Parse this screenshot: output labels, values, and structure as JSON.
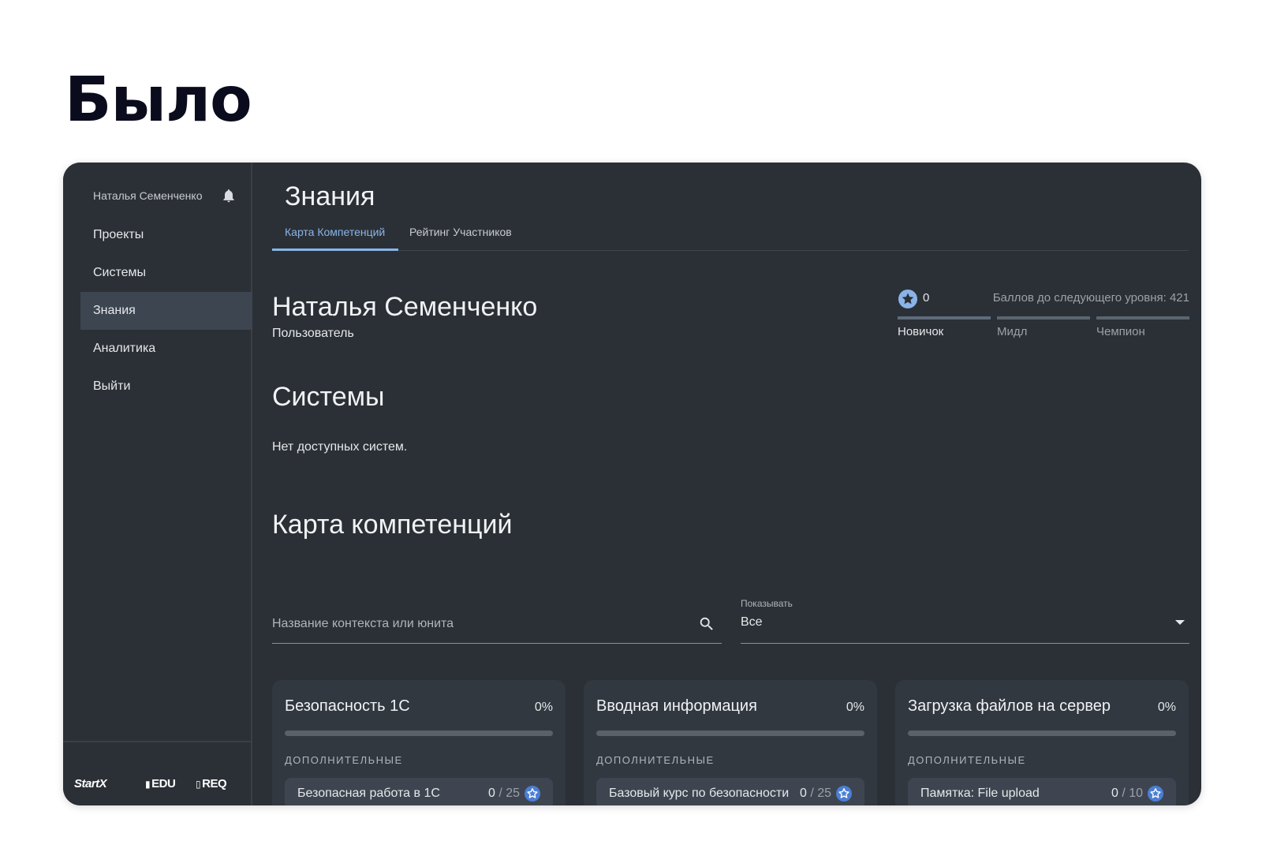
{
  "slide": {
    "title": "Было"
  },
  "sidebar": {
    "user_name": "Наталья Семенченко",
    "items": [
      {
        "label": "Проекты",
        "active": false
      },
      {
        "label": "Системы",
        "active": false
      },
      {
        "label": "Знания",
        "active": true
      },
      {
        "label": "Аналитика",
        "active": false
      },
      {
        "label": "Выйти",
        "active": false
      }
    ],
    "logos": [
      "StartX",
      "EDU",
      "REQ"
    ]
  },
  "main": {
    "page_title": "Знания",
    "tabs": [
      {
        "label": "Карта Компетенций",
        "active": true
      },
      {
        "label": "Рейтинг Участников",
        "active": false
      }
    ],
    "profile": {
      "name": "Наталья Семенченко",
      "role": "Пользователь",
      "points": "0",
      "next_level_text": "Баллов до следующего уровня: 421",
      "levels": [
        "Новичок",
        "Мидл",
        "Чемпион"
      ],
      "current_level": "Новичок"
    },
    "systems": {
      "heading": "Системы",
      "empty_text": "Нет доступных систем."
    },
    "competency_map": {
      "heading": "Карта компетенций",
      "search_placeholder": "Название контекста или юнита",
      "filter_label": "Показывать",
      "filter_value": "Все"
    },
    "cards": [
      {
        "title": "Безопасность 1С",
        "percent": "0%",
        "progress": 0,
        "section": "ДОПОЛНИТЕЛЬНЫЕ",
        "unit": {
          "title": "Безопасная работа в 1С",
          "score": "0",
          "total": "/ 25"
        }
      },
      {
        "title": "Вводная информация",
        "percent": "0%",
        "progress": 0,
        "section": "ДОПОЛНИТЕЛЬНЫЕ",
        "unit": {
          "title": "Базовый курс по безопасности",
          "score": "0",
          "total": "/ 25"
        }
      },
      {
        "title": "Загрузка файлов на сервер",
        "percent": "0%",
        "progress": 0,
        "section": "ДОПОЛНИТЕЛЬНЫЕ",
        "unit": {
          "title": "Памятка: File upload",
          "score": "0",
          "total": "/ 10"
        }
      }
    ]
  },
  "colors": {
    "background": "#2b3036",
    "accent": "#8ab4e8",
    "star": "#4a7fd4",
    "sidebar_active": "#3c4550"
  },
  "icons": [
    "bell-icon",
    "star-icon",
    "search-icon",
    "chevron-down-icon"
  ]
}
